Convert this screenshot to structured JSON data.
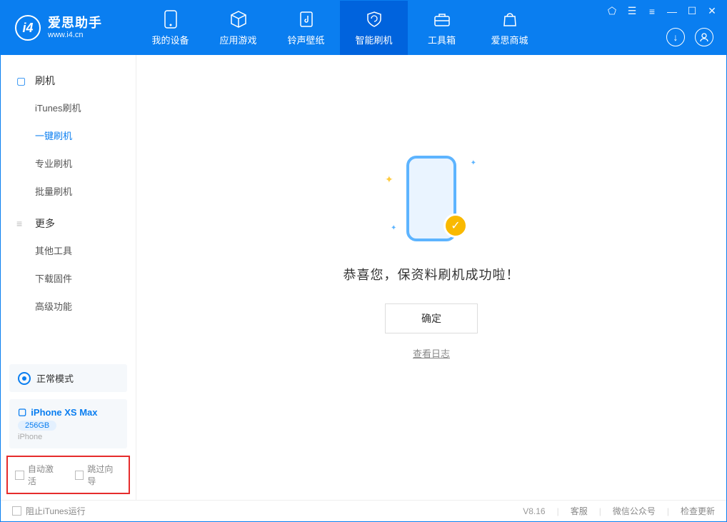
{
  "app": {
    "title": "爱思助手",
    "subtitle": "www.i4.cn"
  },
  "nav": {
    "items": [
      {
        "label": "我的设备"
      },
      {
        "label": "应用游戏"
      },
      {
        "label": "铃声壁纸"
      },
      {
        "label": "智能刷机"
      },
      {
        "label": "工具箱"
      },
      {
        "label": "爱思商城"
      }
    ]
  },
  "sidebar": {
    "group1": {
      "title": "刷机",
      "items": [
        "iTunes刷机",
        "一键刷机",
        "专业刷机",
        "批量刷机"
      ]
    },
    "group2": {
      "title": "更多",
      "items": [
        "其他工具",
        "下载固件",
        "高级功能"
      ]
    }
  },
  "mode": {
    "label": "正常模式"
  },
  "device": {
    "name": "iPhone XS Max",
    "capacity": "256GB",
    "type": "iPhone"
  },
  "checks": {
    "a": "自动激活",
    "b": "跳过向导"
  },
  "main": {
    "message": "恭喜您，保资料刷机成功啦！",
    "ok": "确定",
    "log": "查看日志"
  },
  "footer": {
    "block": "阻止iTunes运行",
    "version": "V8.16",
    "kefu": "客服",
    "wx": "微信公众号",
    "update": "检查更新"
  }
}
